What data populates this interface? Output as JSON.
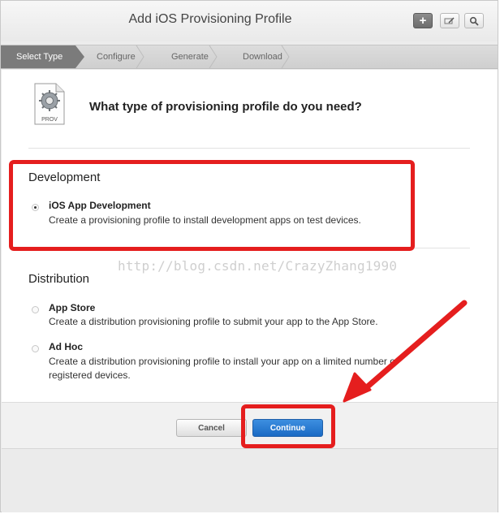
{
  "window": {
    "title": "Add iOS Provisioning Profile",
    "toolbar_icons": [
      "plus-icon",
      "edit-icon",
      "search-icon"
    ]
  },
  "steps": [
    {
      "label": "Select Type",
      "active": true
    },
    {
      "label": "Configure",
      "active": false
    },
    {
      "label": "Generate",
      "active": false
    },
    {
      "label": "Download",
      "active": false
    }
  ],
  "header_icon": {
    "label": "PROV"
  },
  "question": "What type of provisioning profile do you need?",
  "development": {
    "title": "Development",
    "options": [
      {
        "label": "iOS App Development",
        "description": "Create a provisioning profile to install development apps on test devices.",
        "selected": true
      }
    ]
  },
  "distribution": {
    "title": "Distribution",
    "options": [
      {
        "label": "App Store",
        "description": "Create a distribution provisioning profile to submit your app to the App Store.",
        "selected": false
      },
      {
        "label": "Ad Hoc",
        "description_line1": "Create a distribution provisioning profile to install your app on a limited number of",
        "description_line2": "registered devices.",
        "selected": false
      }
    ]
  },
  "watermark": "http://blog.csdn.net/CrazyZhang1990",
  "buttons": {
    "cancel": "Cancel",
    "continue": "Continue"
  },
  "colors": {
    "accent": "#1a6ac4",
    "annotation": "#e51e1e",
    "active_step": "#7b7b7b"
  }
}
